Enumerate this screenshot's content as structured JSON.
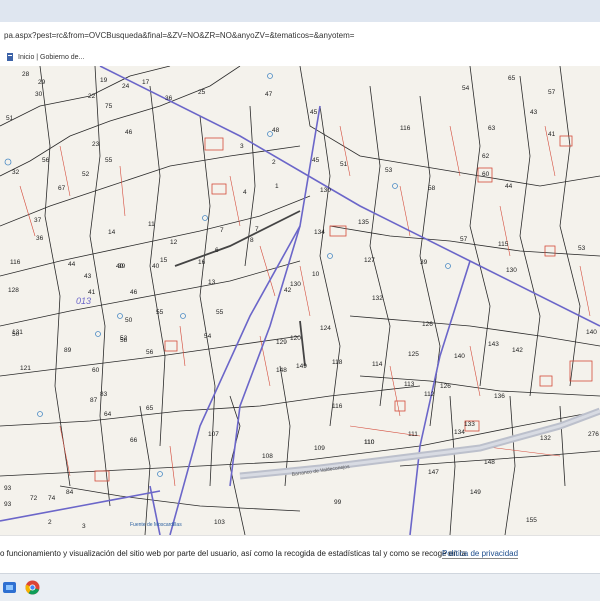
{
  "browser": {
    "url": "pa.aspx?pest=rc&from=OVCBusqueda&final=&ZV=NO&ZR=NO&anyoZV=&tematicos=&anyotem=",
    "bookmark_label": "Inicio | Gobierno de..."
  },
  "map": {
    "parcel_labels": [
      "29",
      "28",
      "19",
      "17",
      "30",
      "47",
      "45",
      "65",
      "54",
      "57",
      "22",
      "75",
      "24",
      "36",
      "25",
      "116",
      "63",
      "51",
      "41",
      "43",
      "23",
      "46",
      "48",
      "2",
      "56",
      "52",
      "55",
      "51",
      "45",
      "62",
      "32",
      "67",
      "3",
      "4",
      "1",
      "130",
      "53",
      "58",
      "60",
      "44",
      "37",
      "14",
      "11",
      "12",
      "7",
      "7",
      "135",
      "57",
      "115",
      "53",
      "36",
      "40",
      "15",
      "16",
      "6",
      "8",
      "134",
      "39",
      "130",
      "116",
      "44",
      "43",
      "39",
      "40",
      "13",
      "10",
      "127",
      "130",
      "128",
      "46",
      "41",
      "42",
      "132",
      "131",
      "50",
      "52",
      "55",
      "55",
      "120",
      "129",
      "124",
      "126",
      "143",
      "142",
      "140",
      "50",
      "89",
      "58",
      "56",
      "54",
      "149",
      "118",
      "114",
      "125",
      "140",
      "60",
      "121",
      "148",
      "136",
      "113",
      "126",
      "65",
      "112",
      "87",
      "83",
      "109",
      "64",
      "116",
      "111",
      "133",
      "134",
      "132",
      "276",
      "66",
      "107",
      "108",
      "110",
      "147",
      "148",
      "84",
      "72",
      "74",
      "93",
      "93",
      "99",
      "110",
      "149",
      "155",
      "2",
      "3",
      "103"
    ],
    "sheet_code": "013",
    "place_labels": [
      "Fuente de Moscardillas",
      "Barranco de Valdeconejos"
    ]
  },
  "cookie_bar": {
    "text": "o funcionamiento y visualización del sitio web por parte del usuario, así como la recogida de estadísticas tal y como se recoge en la",
    "link": "Política de privacidad"
  },
  "colors": {
    "parcel_line": "#2a2a2a",
    "road_line": "#6b66c9",
    "building": "#d44a3a",
    "label": "#222222",
    "water": "#4a8ac4"
  }
}
